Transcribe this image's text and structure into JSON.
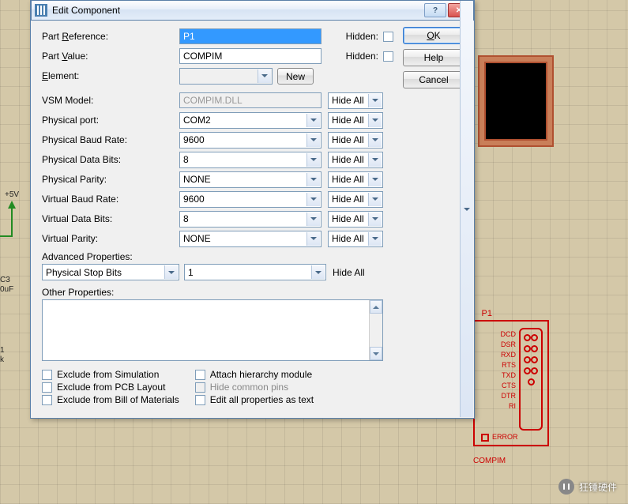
{
  "dialog": {
    "title": "Edit Component",
    "buttons": {
      "ok": "OK",
      "help": "Help",
      "cancel": "Cancel"
    },
    "labels": {
      "part_reference": "Part Reference:",
      "part_value": "Part Value:",
      "element": "Element:",
      "new": "New",
      "hidden": "Hidden:",
      "vsm_model": "VSM Model:",
      "physical_port": "Physical port:",
      "physical_baud": "Physical Baud Rate:",
      "physical_data_bits": "Physical Data Bits:",
      "physical_parity": "Physical Parity:",
      "virtual_baud": "Virtual Baud Rate:",
      "virtual_data_bits": "Virtual Data Bits:",
      "virtual_parity": "Virtual Parity:",
      "advanced": "Advanced Properties:",
      "other": "Other Properties:",
      "hide_all": "Hide All"
    },
    "values": {
      "part_reference": "P1",
      "part_value": "COMPIM",
      "vsm_model": "COMPIM.DLL",
      "physical_port": "COM2",
      "physical_baud": "9600",
      "physical_data_bits": "8",
      "physical_parity": "NONE",
      "virtual_baud": "9600",
      "virtual_data_bits": "8",
      "virtual_parity": "NONE",
      "adv_name": "Physical Stop Bits",
      "adv_value": "1"
    },
    "checks": {
      "exclude_sim": "Exclude from Simulation",
      "exclude_pcb": "Exclude from PCB Layout",
      "exclude_bom": "Exclude from Bill of Materials",
      "attach_hier": "Attach hierarchy module",
      "hide_common": "Hide common pins",
      "edit_all": "Edit all properties as text"
    }
  },
  "schematic": {
    "plus5v": "+5V",
    "c3": "C3",
    "c3_val": "0uF",
    "j1": "1",
    "j1_val": "k"
  },
  "compim": {
    "ref": "P1",
    "name": "COMPIM",
    "error": "ERROR",
    "pins": [
      "DCD",
      "DSR",
      "RXD",
      "RTS",
      "TXD",
      "CTS",
      "DTR",
      "RI"
    ]
  },
  "watermark": "狂锤硬件"
}
